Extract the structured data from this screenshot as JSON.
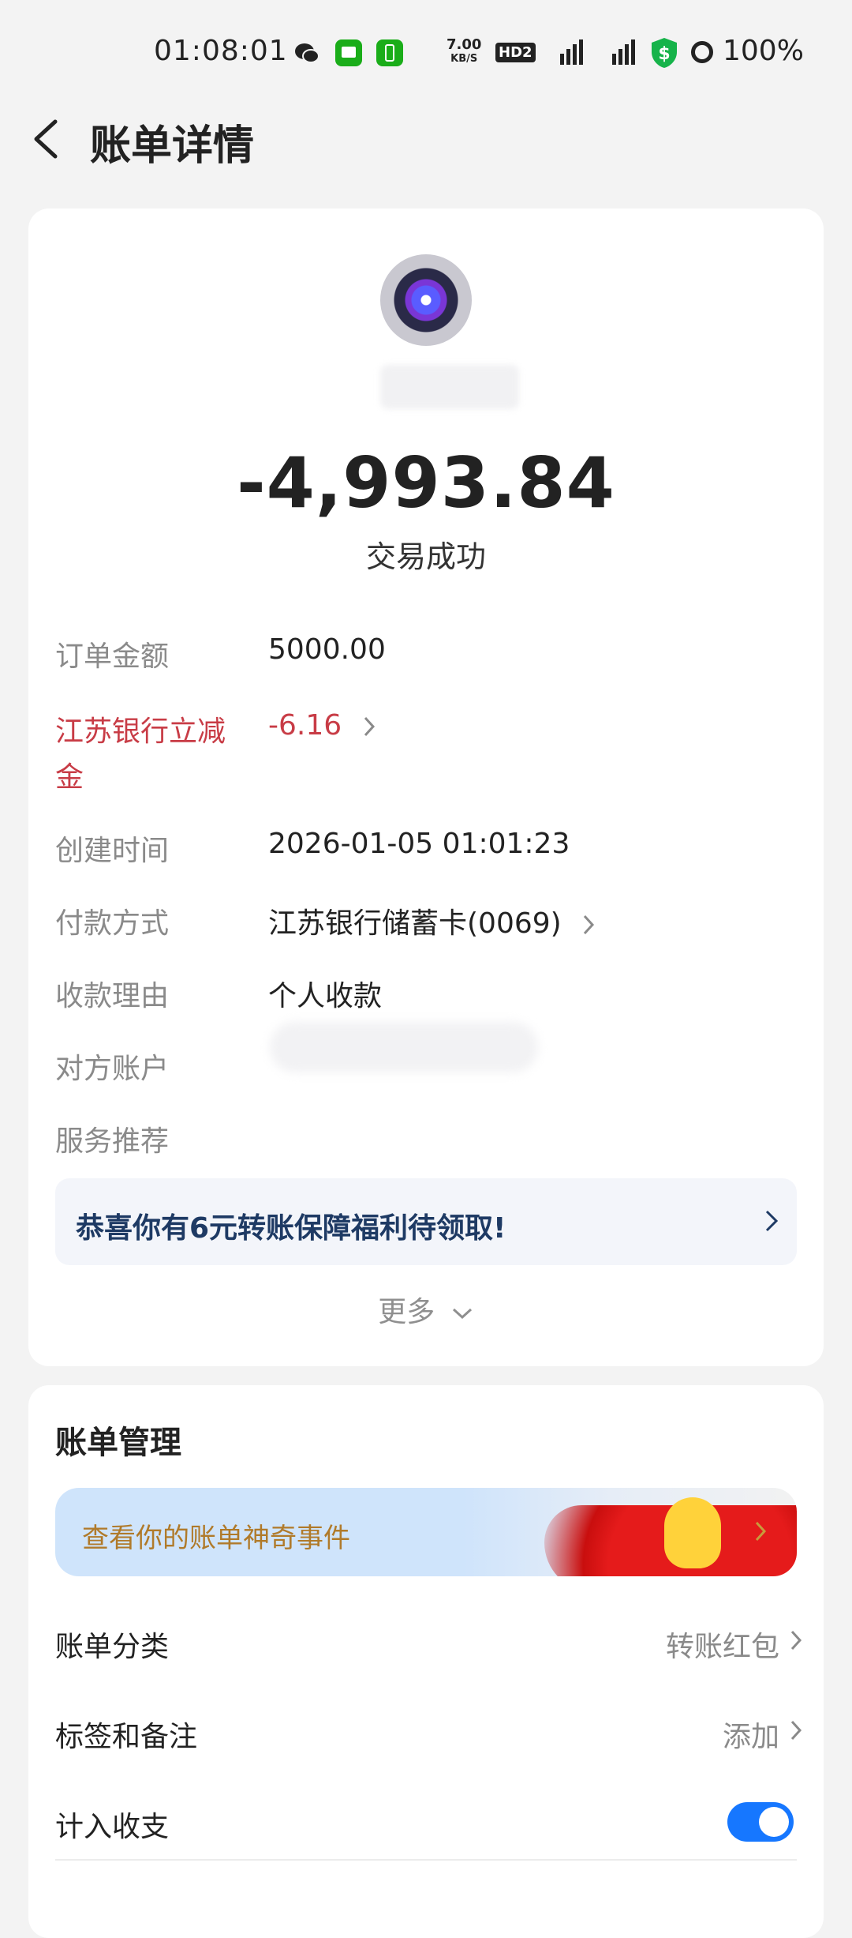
{
  "status_bar": {
    "time": "01:08:01",
    "speed_value": "7.00",
    "speed_unit": "KB/S",
    "hd_label": "HD2",
    "battery": "100%"
  },
  "header": {
    "title": "账单详情"
  },
  "transaction": {
    "amount": "-4,993.84",
    "status": "交易成功"
  },
  "details": [
    {
      "label": "订单金额",
      "value": "5000.00"
    },
    {
      "label": "江苏银行立减金",
      "value": "-6.16"
    },
    {
      "label": "创建时间",
      "value": "2026-01-05 01:01:23"
    },
    {
      "label": "付款方式",
      "value": "江苏银行储蓄卡(0069)"
    },
    {
      "label": "收款理由",
      "value": "个人收款"
    },
    {
      "label": "对方账户",
      "value": ""
    },
    {
      "label": "服务推荐",
      "value": ""
    }
  ],
  "promo": {
    "text": "恭喜你有6元转账保障福利待领取!"
  },
  "more_label": "更多",
  "management": {
    "title": "账单管理",
    "banner_text": "查看你的账单神奇事件",
    "rows": [
      {
        "label": "账单分类",
        "value": "转账红包"
      },
      {
        "label": "标签和备注",
        "value": "添加"
      },
      {
        "label": "计入收支",
        "value": ""
      }
    ]
  },
  "colors": {
    "accent_red": "#c83c46",
    "toggle_blue": "#1677ff"
  }
}
